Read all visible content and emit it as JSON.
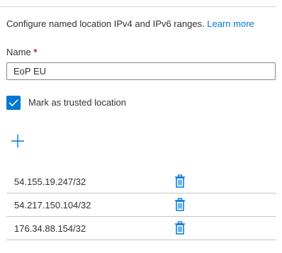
{
  "description": {
    "text": "Configure named location IPv4 and IPv6 ranges.",
    "link": "Learn more"
  },
  "name_field": {
    "label": "Name",
    "required_marker": "*",
    "value": "EoP EU"
  },
  "trusted_checkbox": {
    "label": "Mark as trusted location",
    "checked": true
  },
  "add_button": {
    "icon": "plus-icon"
  },
  "ip_ranges": [
    {
      "value": "54.155.19.247/32",
      "action_icon": "trash-icon"
    },
    {
      "value": "54.217.150.104/32",
      "action_icon": "trash-icon"
    },
    {
      "value": "176.34.88.154/32",
      "action_icon": "trash-icon"
    }
  ],
  "colors": {
    "accent": "#0078d4",
    "text": "#323130",
    "required": "#a4262c",
    "divider": "#c8c6c4"
  }
}
